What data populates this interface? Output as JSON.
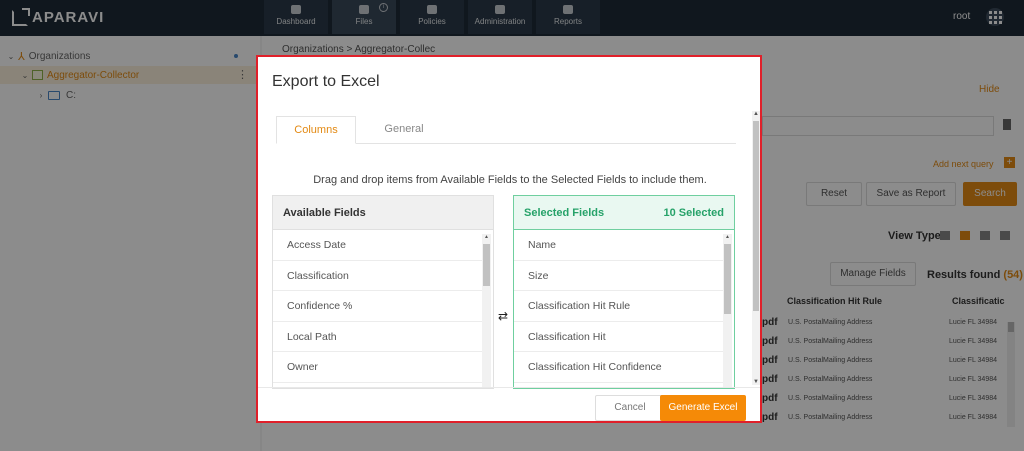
{
  "app": {
    "logo_text": "APARAVI",
    "user": "root"
  },
  "nav": [
    {
      "label": "Dashboard",
      "icon": "dashboard-icon"
    },
    {
      "label": "Files",
      "icon": "folder-icon",
      "badge": "i",
      "active": true
    },
    {
      "label": "Policies",
      "icon": "gear-icon"
    },
    {
      "label": "Administration",
      "icon": "users-icon"
    },
    {
      "label": "Reports",
      "icon": "clipboard-icon"
    }
  ],
  "tree": {
    "organizations": "Organizations",
    "collector": "Aggregator-Collector",
    "drive": "C:"
  },
  "main": {
    "breadcrumb_1": "Organizations",
    "breadcrumb_sep": ">",
    "breadcrumb_2": "Aggregator-Collec",
    "hide": "Hide",
    "add_next_query": "Add next query",
    "reset": "Reset",
    "save_as_report": "Save as Report",
    "search": "Search",
    "view_type": "View Type",
    "manage_fields": "Manage Fields",
    "results_label": "Results found",
    "results_count": "(54)",
    "col_hit_rule": "Classification Hit Rule",
    "col_classific": "Classificatic",
    "rows": [
      {
        "ext": "pdf",
        "rule": "U.S. PostalMailing Address",
        "hit": "Lucie FL 34984"
      },
      {
        "ext": "pdf",
        "rule": "U.S. PostalMailing Address",
        "hit": "Lucie FL 34984"
      },
      {
        "ext": "pdf",
        "rule": "U.S. PostalMailing Address",
        "hit": "Lucie FL 34984"
      },
      {
        "ext": "pdf",
        "rule": "U.S. PostalMailing Address",
        "hit": "Lucie FL 34984"
      },
      {
        "ext": "pdf",
        "rule": "U.S. PostalMailing Address",
        "hit": "Lucie FL 34984"
      },
      {
        "ext": "pdf",
        "rule": "U.S. PostalMailing Address",
        "hit": "Lucie FL 34984"
      }
    ]
  },
  "modal": {
    "title": "Export to Excel",
    "tabs": [
      "Columns",
      "General"
    ],
    "hint": "Drag and drop items from Available Fields to the Selected Fields to include them.",
    "available_title": "Available Fields",
    "available_fields": [
      "Access Date",
      "Classification",
      "Confidence %",
      "Local Path",
      "Owner"
    ],
    "selected_title": "Selected Fields",
    "selected_count": "10 Selected",
    "selected_fields": [
      "Name",
      "Size",
      "Classification Hit Rule",
      "Classification Hit",
      "Classification Hit Confidence"
    ],
    "cancel": "Cancel",
    "generate": "Generate Excel"
  },
  "colors": {
    "accent": "#f58a07",
    "selected_green": "#26a269",
    "highlight_border": "#e0202a",
    "nav_bg": "#1e2b38"
  }
}
